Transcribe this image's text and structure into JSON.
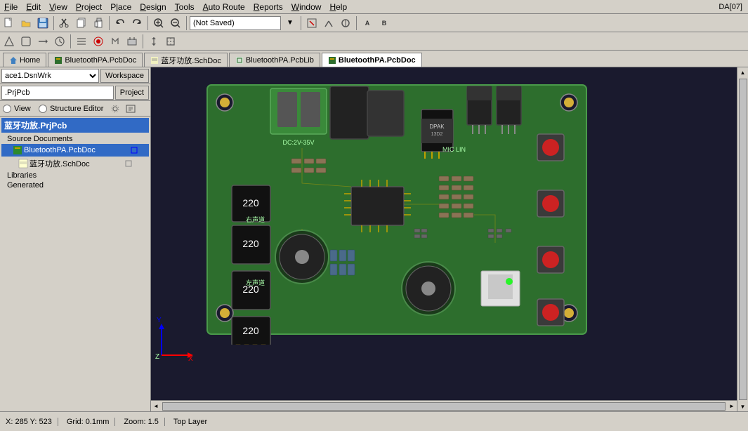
{
  "menubar": {
    "items": [
      {
        "label": "File",
        "underline": "F"
      },
      {
        "label": "Edit",
        "underline": "E"
      },
      {
        "label": "View",
        "underline": "V"
      },
      {
        "label": "Project",
        "underline": "P"
      },
      {
        "label": "Place",
        "underline": "l"
      },
      {
        "label": "Design",
        "underline": "D"
      },
      {
        "label": "Tools",
        "underline": "T"
      },
      {
        "label": "Auto Route",
        "underline": "A"
      },
      {
        "label": "Reports",
        "underline": "R"
      },
      {
        "label": "Window",
        "underline": "W"
      },
      {
        "label": "Help",
        "underline": "H"
      }
    ],
    "topright": "DA[07]"
  },
  "toolbar": {
    "not_saved": "(Not Saved)"
  },
  "tabbar": {
    "tabs": [
      {
        "label": "Home",
        "type": "home",
        "active": false
      },
      {
        "label": "BluetoothPA.PcbDoc",
        "type": "pcb",
        "active": false
      },
      {
        "label": "蓝牙功放.SchDoc",
        "type": "sch",
        "active": false
      },
      {
        "label": "BluetoothPA.PcbLib",
        "type": "lib",
        "active": false
      },
      {
        "label": "BluetoothPA.PcbDoc",
        "type": "pcb",
        "active": true
      }
    ]
  },
  "leftpanel": {
    "workspace_label": "Workspace",
    "project_label": "Project",
    "workspace_value": "ace1.DsnWrk",
    "project_value": ".PrjPcb",
    "view_label": "View",
    "structure_editor_label": "Structure Editor",
    "tree": {
      "root": "蓝牙功放.PrjPcb",
      "source_documents": "Source Documents",
      "items": [
        {
          "label": "BluetoothPA.PcbDoc",
          "selected": true,
          "type": "pcbdoc"
        },
        {
          "label": "蓝牙功放.SchDoc",
          "selected": false,
          "type": "schdoc"
        }
      ],
      "libraries": "Libraries",
      "generated": "Generated"
    }
  },
  "statusbar": {
    "coords": "X: 285  Y: 523",
    "grid": "Grid: 0.1mm",
    "zoom": "Zoom: 1.5",
    "layer": "Top Layer"
  },
  "pcb": {
    "board_color": "#2d6e2d",
    "bg_color": "#1a1a2e"
  }
}
